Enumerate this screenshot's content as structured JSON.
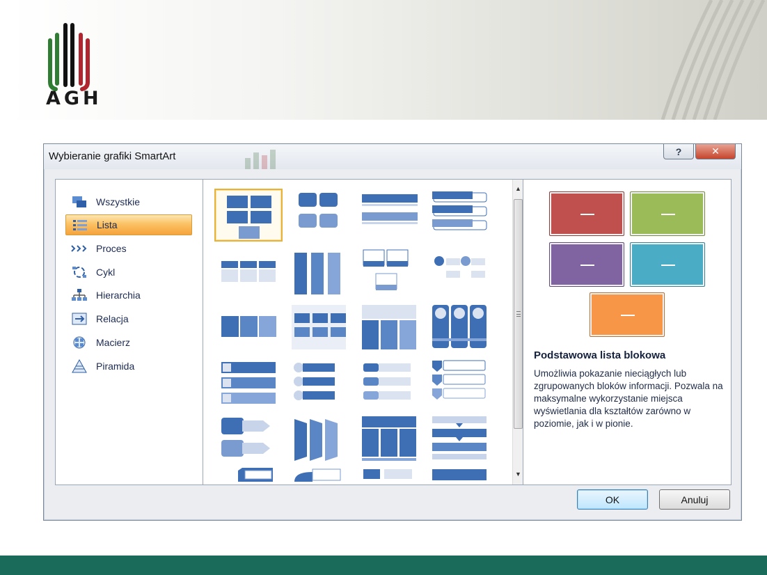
{
  "slide": {
    "logo_text": "AGH",
    "colors": {
      "footer": "#1b6b5a",
      "logo_green": "#2e7d32",
      "logo_red": "#b0252f"
    }
  },
  "dialog": {
    "title": "Wybieranie grafiki SmartArt",
    "help_icon": "?",
    "close_icon": "✕",
    "categories": [
      {
        "label": "Wszystkie",
        "icon": "all-layouts-icon",
        "selected": false
      },
      {
        "label": "Lista",
        "icon": "list-icon",
        "selected": true
      },
      {
        "label": "Proces",
        "icon": "process-icon",
        "selected": false
      },
      {
        "label": "Cykl",
        "icon": "cycle-icon",
        "selected": false
      },
      {
        "label": "Hierarchia",
        "icon": "hierarchy-icon",
        "selected": false
      },
      {
        "label": "Relacja",
        "icon": "relationship-icon",
        "selected": false
      },
      {
        "label": "Macierz",
        "icon": "matrix-icon",
        "selected": false
      },
      {
        "label": "Piramida",
        "icon": "pyramid-icon",
        "selected": false
      }
    ],
    "preview": {
      "title": "Podstawowa lista blokowa",
      "description": "Umożliwia pokazanie nieciągłych lub zgrupowanych bloków informacji. Pozwala na maksymalne wykorzystanie miejsca wyświetlania dla kształtów zarówno w poziomie, jak i w pionie.",
      "block_colors": [
        "#c0504d",
        "#9bbb59",
        "#8064a2",
        "#4bacc6",
        "#f79646"
      ]
    },
    "scroll_up_icon": "▲",
    "scroll_down_icon": "▼",
    "ok_label": "OK",
    "cancel_label": "Anuluj"
  }
}
